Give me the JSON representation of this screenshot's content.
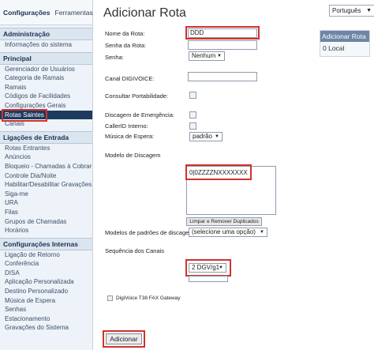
{
  "sidebar": {
    "tabs": [
      "Configurações",
      "Ferramentas"
    ],
    "sections": [
      {
        "title": "Administração",
        "items": [
          "Informações do sistema"
        ]
      },
      {
        "title": "Principal",
        "items": [
          "Gerenciador de Usuários",
          "Categoria de Ramais",
          "Ramais",
          "Códigos de Facilidades",
          "Configurações Gerais",
          "Rotas Saintes",
          "Canais"
        ]
      },
      {
        "title": "Ligações de Entrada",
        "items": [
          "Rotas Entrantes",
          "Anúncios",
          "Bloqueio - Chamadas à Cobrar",
          "Controle Dia/Noite",
          "Habilitar/Desabilitar Gravações",
          "Siga-me",
          "URA",
          "Filas",
          "Grupos de Chamadas",
          "Horários"
        ]
      },
      {
        "title": "Configurações Internas",
        "items": [
          "Ligação de Retorno",
          "Conferência",
          "DISA",
          "Aplicação Personalizada",
          "Destino Personalizado",
          "Música de Espera",
          "Senhas",
          "Estacionamento",
          "Gravações do Sistema"
        ]
      }
    ],
    "selected_item": "Rotas Saintes"
  },
  "main": {
    "title": "Adicionar Rota",
    "language": "Português",
    "fields": {
      "route_name_label": "Nome da Rota:",
      "route_name_value": "DDD",
      "route_password_label": "Senha da Rota:",
      "password_label": "Senha:",
      "password_value": "Nenhum",
      "digivoice_label": "Canal DIGIVOICE:",
      "portability_label": "Consultar Portabilidade:",
      "emergency_label": "Discagem de Emergência:",
      "callerid_label": "CallerID Interno:",
      "hold_music_label": "Música de Espera:",
      "hold_music_value": "padrão",
      "dial_pattern_label": "Modelo de Discagem",
      "dial_pattern_value": "0|0ZZZZNXXXXXXX",
      "clear_button": "Limpar e Remover Duplicados",
      "dial_patterns_select_label": "Modelos de padrões de discagem:",
      "dial_patterns_select_value": "(selecione uma opção)",
      "channel_sequence_label": "Sequência dos Canais",
      "channel_sequence_value": "2 DGV/g1",
      "fax_gateway_label": "DigiVoice T38 FAX Gateway",
      "submit_button": "Adicionar"
    }
  },
  "right_panel": {
    "header": "Adicionar Rota",
    "item": "0 Local"
  },
  "colors": {
    "highlight": "#d0312d",
    "selected_nav_bg": "#1e3a5f",
    "panel_header_bg": "#6d86a6"
  }
}
